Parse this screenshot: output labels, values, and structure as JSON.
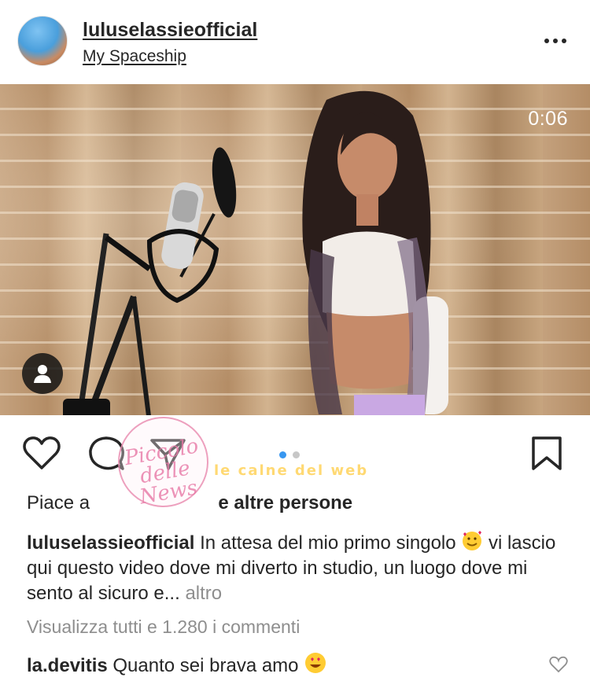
{
  "header": {
    "username": "luluselassieofficial",
    "location": "My Spaceship"
  },
  "media": {
    "timer": "0:06"
  },
  "likes": {
    "prefix": "Piace a",
    "suffix": "e altre persone"
  },
  "caption": {
    "username": "luluselassieofficial",
    "text_part1": "In attesa del mio primo singolo",
    "text_part2": "vi lascio qui questo video dove mi diverto in studio, un luogo dove mi sento al sicuro e...",
    "more_label": "altro"
  },
  "view_all_comments": "Visualizza tutti e 1.280 i commenti",
  "comment": {
    "username": "la.devitis",
    "text": "Quanto sei brava amo"
  },
  "watermarks": {
    "circle_text": "Piccolo delle News",
    "banner_text": "le calne del web"
  },
  "colors": {
    "text": "#262626",
    "secondary": "#8e8e8e",
    "dot_active": "#3897f0",
    "dot_inactive": "#c7c7c7"
  },
  "icons": [
    "more-icon",
    "user-tag-icon",
    "heart-icon",
    "comment-icon",
    "share-icon",
    "bookmark-icon",
    "like-comment-icon"
  ],
  "carousel": {
    "total": 2,
    "active": 1
  }
}
